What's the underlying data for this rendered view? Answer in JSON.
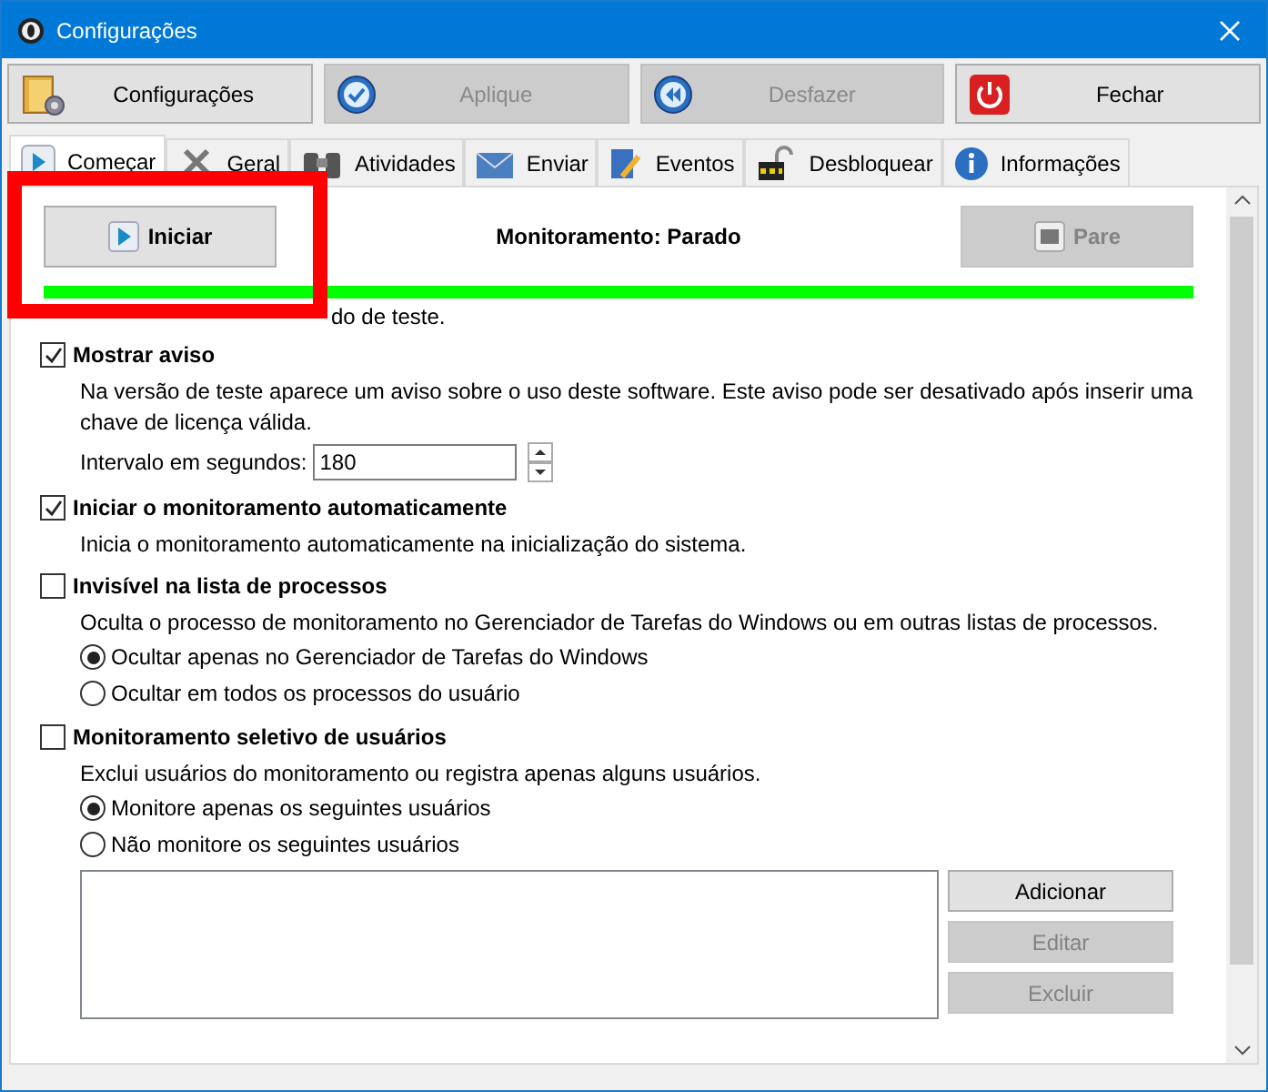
{
  "window": {
    "title": "Configurações"
  },
  "toolbar": [
    {
      "label": "Configurações",
      "disabled": false
    },
    {
      "label": "Aplique",
      "disabled": true
    },
    {
      "label": "Desfazer",
      "disabled": true
    },
    {
      "label": "Fechar",
      "disabled": false
    }
  ],
  "tabs": [
    {
      "label": "Começar",
      "selected": true
    },
    {
      "label": "Geral",
      "selected": false
    },
    {
      "label": "Atividades",
      "selected": false
    },
    {
      "label": "Enviar",
      "selected": false
    },
    {
      "label": "Eventos",
      "selected": false
    },
    {
      "label": "Desbloquear",
      "selected": false
    },
    {
      "label": "Informações",
      "selected": false
    }
  ],
  "start_button": {
    "label": "Iniciar",
    "disabled": false
  },
  "status": "Monitoramento: Parado",
  "stop_button": {
    "label": "Pare",
    "disabled": true
  },
  "progress": {
    "level": 1
  },
  "note": "do de teste.",
  "sections": [
    {
      "title": "Mostrar aviso",
      "checked": true,
      "description": "Na versão de teste aparece um aviso sobre o uso deste software. Este aviso pode ser desativado após inserir uma chave de licença válida.",
      "interval": {
        "label": "Intervalo em segundos:",
        "value": "180"
      }
    },
    {
      "title": "Iniciar o monitoramento automaticamente",
      "checked": true,
      "description": "Inicia o monitoramento automaticamente na inicialização do sistema."
    },
    {
      "title": "Invisível na lista de processos",
      "checked": false,
      "description": "Oculta o processo de monitoramento no Gerenciador de Tarefas do Windows ou em outras listas de processos.",
      "radios": [
        {
          "label": "Ocultar apenas no Gerenciador de Tarefas do Windows",
          "selected": true
        },
        {
          "label": "Ocultar em todos os processos do usuário",
          "selected": false
        }
      ]
    },
    {
      "title": "Monitoramento seletivo de usuários",
      "checked": false,
      "description": "Exclui usuários do monitoramento ou registra apenas alguns usuários.",
      "radios": [
        {
          "label": "Monitore apenas os seguintes usuários",
          "selected": true
        },
        {
          "label": "Não monitore os seguintes usuários",
          "selected": false
        }
      ],
      "list_buttons": [
        {
          "label": "Adicionar",
          "disabled": false
        },
        {
          "label": "Editar",
          "disabled": true
        },
        {
          "label": "Excluir",
          "disabled": true
        }
      ]
    }
  ]
}
